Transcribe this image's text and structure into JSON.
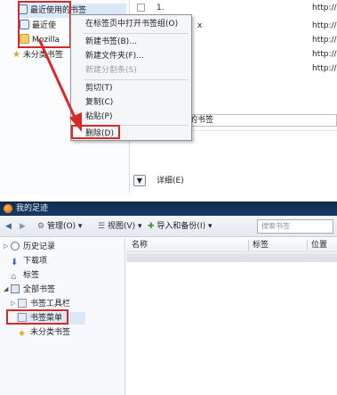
{
  "top_panel": {
    "tree": [
      {
        "label": "最近使用的书签",
        "icon": "bookmark-page-icon"
      },
      {
        "label": "最近使",
        "icon": "bookmark-page-icon"
      },
      {
        "label": "Mozilla",
        "icon": "folder-icon"
      },
      {
        "label": "未分类书签",
        "icon": "star-icon"
      }
    ],
    "list_rows": [
      {
        "name": "1.",
        "location": "http://"
      },
      {
        "name": "x",
        "location": "http://"
      },
      {
        "name": "",
        "location": "http://"
      },
      {
        "name": "",
        "location": "http://"
      },
      {
        "name": "",
        "location": "http://"
      }
    ],
    "details_field_value": "用的书签",
    "detail_toggle_label": "详细(E)"
  },
  "context_menu": {
    "items": [
      {
        "label": "在标签页中打开书签组(O)",
        "disabled": false
      },
      {
        "label": "新建书签(B)...",
        "disabled": false
      },
      {
        "label": "新建文件夹(F)...",
        "disabled": false
      },
      {
        "label": "新建分割条(S)",
        "disabled": true
      },
      {
        "label": "剪切(T)",
        "disabled": false
      },
      {
        "label": "复制(C)",
        "disabled": false
      },
      {
        "label": "粘贴(P)",
        "disabled": false
      },
      {
        "label": "删除(D)",
        "disabled": false
      }
    ]
  },
  "library": {
    "title": "我的足迹",
    "toolbar": {
      "back": "◀",
      "forward": "▶",
      "organize": "管理(O)",
      "views": "视图(V)",
      "import_backup": "导入和备份(I)",
      "search_placeholder": "搜索书签"
    },
    "sidebar": [
      {
        "label": "历史记录",
        "icon": "history-clock-icon"
      },
      {
        "label": "下载项",
        "icon": "download-arrow-icon"
      },
      {
        "label": "标签",
        "icon": "tag-icon"
      },
      {
        "label": "全部书签",
        "icon": "all-bookmarks-icon"
      },
      {
        "label": "书签工具栏",
        "icon": "bookmarks-toolbar-icon"
      },
      {
        "label": "书签菜单",
        "icon": "bookmarks-menu-icon"
      },
      {
        "label": "未分类书签",
        "icon": "star-icon"
      }
    ],
    "columns": [
      "名称",
      "标签",
      "位置"
    ]
  },
  "colors": {
    "highlight_red": "#d62a2a",
    "selection_blue": "#dbe8f7",
    "titlebar_dark": "#0f2c50"
  }
}
